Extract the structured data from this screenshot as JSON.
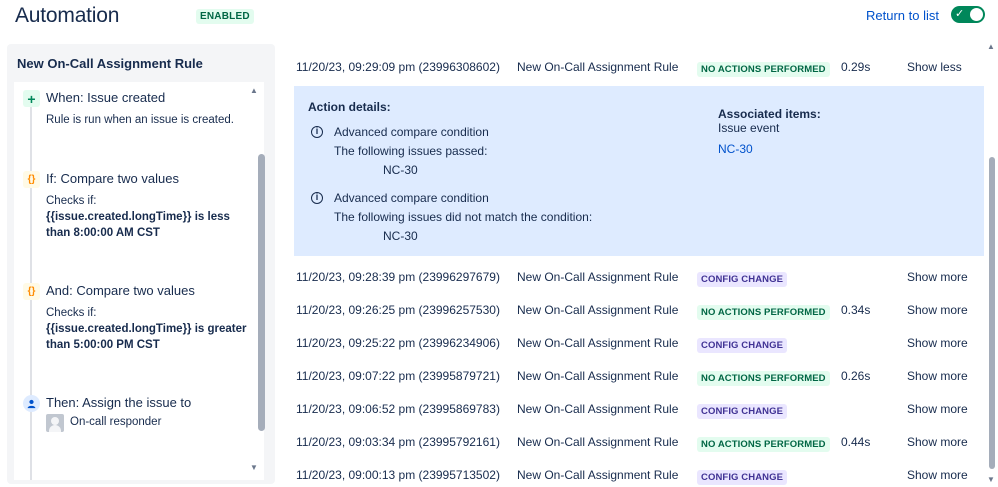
{
  "header": {
    "title": "Automation",
    "badge": "ENABLED",
    "return_link": "Return to list",
    "toggle_icon": "check-icon"
  },
  "rule_panel": {
    "title": "New On-Call Assignment Rule",
    "steps": [
      {
        "icon": "plus-icon",
        "title": "When: Issue created",
        "desc": "Rule is run when an issue is created."
      },
      {
        "icon": "braces-icon",
        "title": "If: Compare two values",
        "desc_prefix": "Checks if:",
        "desc_bold": "{{issue.created.longTime}} is less than 8:00:00 AM CST"
      },
      {
        "icon": "braces-icon",
        "title": "And: Compare two values",
        "desc_prefix": "Checks if:",
        "desc_bold": "{{issue.created.longTime}} is greater than 5:00:00 PM CST"
      },
      {
        "icon": "user-circle-icon",
        "title": "Then: Assign the issue to",
        "assignee": "On-call responder"
      }
    ]
  },
  "colors": {
    "success_bg": "#e3fcef",
    "success_fg": "#006644",
    "config_bg": "#eae6ff",
    "config_fg": "#403294",
    "details_bg": "#deebff",
    "link": "#0052cc",
    "toggle_on": "#00875a"
  },
  "log": {
    "expanded": {
      "timestamp": "11/20/23, 09:29:09 pm (23996308602)",
      "rule": "New On-Call Assignment Rule",
      "status": "NO ACTIONS PERFORMED",
      "duration": "0.29s",
      "toggle": "Show less"
    },
    "details": {
      "header": "Action details:",
      "items": [
        {
          "title": "Advanced compare condition",
          "line": "The following issues passed:",
          "issue": "NC-30"
        },
        {
          "title": "Advanced compare condition",
          "line": "The following issues did not match the condition:",
          "issue": "NC-30"
        }
      ],
      "assoc_title": "Associated items:",
      "assoc_sub": "Issue event",
      "assoc_link": "NC-30"
    },
    "rows": [
      {
        "timestamp": "11/20/23, 09:28:39 pm (23996297679)",
        "rule": "New On-Call Assignment Rule",
        "status": "CONFIG CHANGE",
        "type": "config",
        "duration": "",
        "toggle": "Show more"
      },
      {
        "timestamp": "11/20/23, 09:26:25 pm (23996257530)",
        "rule": "New On-Call Assignment Rule",
        "status": "NO ACTIONS PERFORMED",
        "type": "success",
        "duration": "0.34s",
        "toggle": "Show more"
      },
      {
        "timestamp": "11/20/23, 09:25:22 pm (23996234906)",
        "rule": "New On-Call Assignment Rule",
        "status": "CONFIG CHANGE",
        "type": "config",
        "duration": "",
        "toggle": "Show more"
      },
      {
        "timestamp": "11/20/23, 09:07:22 pm (23995879721)",
        "rule": "New On-Call Assignment Rule",
        "status": "NO ACTIONS PERFORMED",
        "type": "success",
        "duration": "0.26s",
        "toggle": "Show more"
      },
      {
        "timestamp": "11/20/23, 09:06:52 pm (23995869783)",
        "rule": "New On-Call Assignment Rule",
        "status": "CONFIG CHANGE",
        "type": "config",
        "duration": "",
        "toggle": "Show more"
      },
      {
        "timestamp": "11/20/23, 09:03:34 pm (23995792161)",
        "rule": "New On-Call Assignment Rule",
        "status": "NO ACTIONS PERFORMED",
        "type": "success",
        "duration": "0.44s",
        "toggle": "Show more"
      },
      {
        "timestamp": "11/20/23, 09:00:13 pm (23995713502)",
        "rule": "New On-Call Assignment Rule",
        "status": "CONFIG CHANGE",
        "type": "config",
        "duration": "",
        "toggle": "Show more"
      }
    ]
  }
}
